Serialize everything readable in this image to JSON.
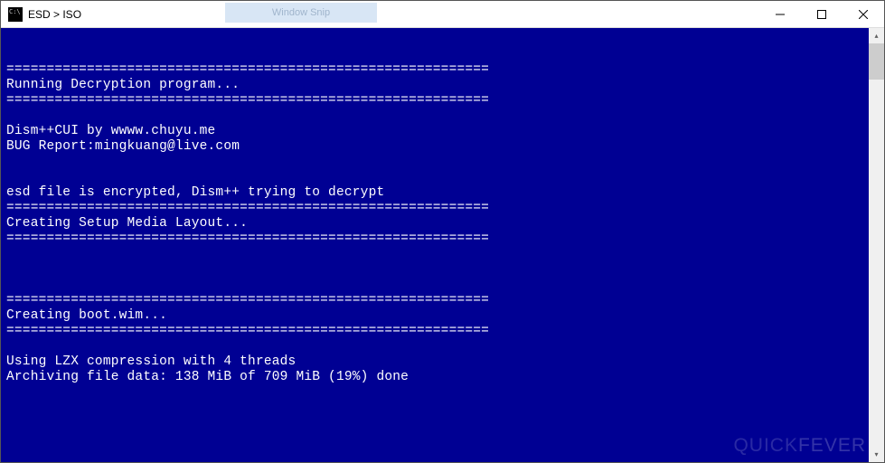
{
  "titlebar": {
    "title": "ESD > ISO",
    "ghost_tab": "Window Snip"
  },
  "console": {
    "lines": [
      "",
      "",
      "============================================================",
      "Running Decryption program...",
      "============================================================",
      "",
      "Dism++CUI by wwww.chuyu.me",
      "BUG Report:mingkuang@live.com",
      "",
      "",
      "esd file is encrypted, Dism++ trying to decrypt",
      "============================================================",
      "Creating Setup Media Layout...",
      "============================================================",
      "",
      "",
      "",
      "============================================================",
      "Creating boot.wim...",
      "============================================================",
      "",
      "Using LZX compression with 4 threads",
      "Archiving file data: 138 MiB of 709 MiB (19%) done"
    ]
  },
  "watermark": {
    "light": "QUICK",
    "bold": "FEVER"
  },
  "colors": {
    "console_bg": "#000093",
    "console_fg": "#ffffff"
  }
}
